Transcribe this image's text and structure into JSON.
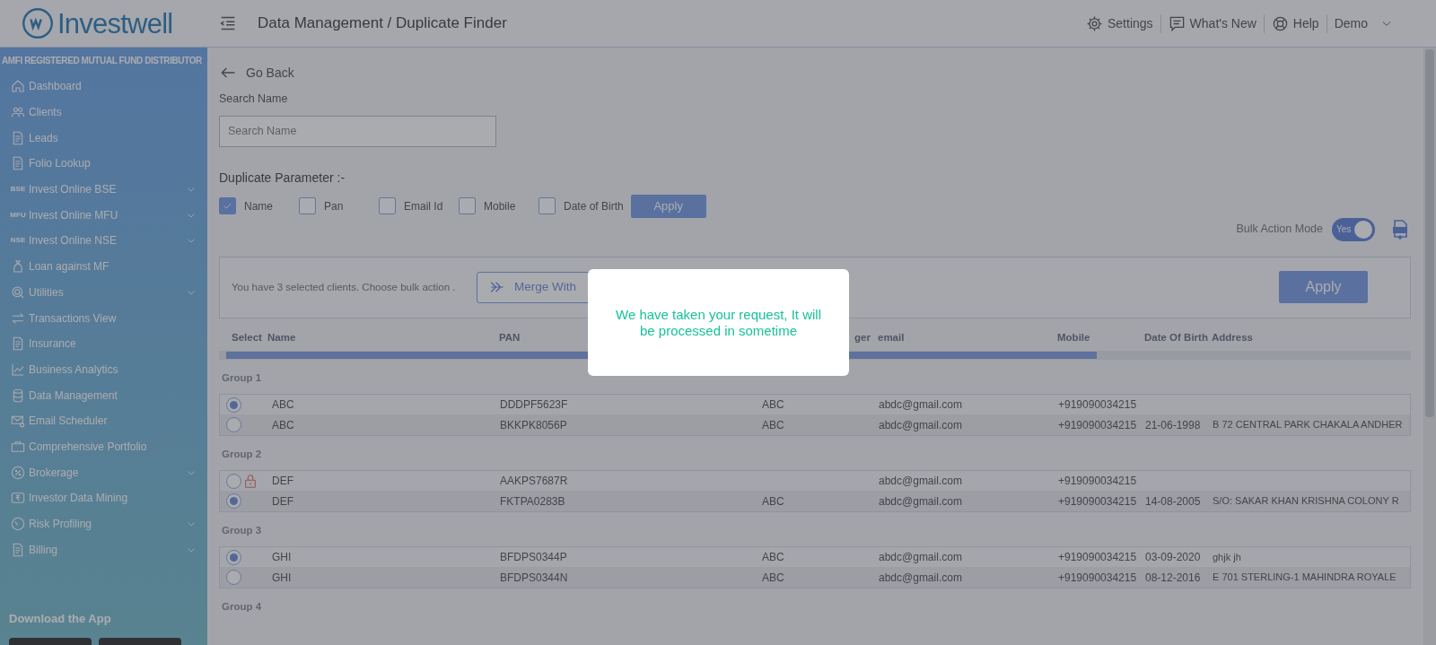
{
  "brand": {
    "name": "Investwell"
  },
  "header": {
    "breadcrumb": "Data Management / Duplicate Finder",
    "links": [
      {
        "label": "Settings",
        "kind": "settings"
      },
      {
        "label": "What's New",
        "kind": "news"
      },
      {
        "label": "Help",
        "kind": "help"
      }
    ],
    "user": "Demo"
  },
  "sidebar": {
    "tagline": "AMFI REGISTERED MUTUAL FUND DISTRIBUTOR",
    "items": [
      {
        "label": "Dashboard",
        "expandable": false
      },
      {
        "label": "Clients",
        "expandable": false
      },
      {
        "label": "Leads",
        "expandable": false
      },
      {
        "label": "Folio Lookup",
        "expandable": false
      },
      {
        "label": "Invest Online BSE",
        "icon_text": "BSE",
        "expandable": true
      },
      {
        "label": "Invest Online MFU",
        "icon_text": "MFU",
        "expandable": true
      },
      {
        "label": "Invest Online NSE",
        "icon_text": "NSE",
        "expandable": true
      },
      {
        "label": "Loan against MF",
        "expandable": false
      },
      {
        "label": "Utilities",
        "expandable": true
      },
      {
        "label": "Transactions View",
        "expandable": false
      },
      {
        "label": "Insurance",
        "expandable": false
      },
      {
        "label": "Business Analytics",
        "expandable": false
      },
      {
        "label": "Data Management",
        "expandable": false
      },
      {
        "label": "Email Scheduler",
        "expandable": false
      },
      {
        "label": "Comprehensive Portfolio",
        "expandable": false
      },
      {
        "label": "Brokerage",
        "expandable": true
      },
      {
        "label": "Investor Data Mining",
        "expandable": false
      },
      {
        "label": "Risk Profiling",
        "expandable": true
      },
      {
        "label": "Billing",
        "expandable": true
      }
    ],
    "download": {
      "title": "Download the App"
    }
  },
  "back": {
    "label": "Go Back"
  },
  "search": {
    "label": "Search Name",
    "placeholder": "Search Name"
  },
  "parameters": {
    "title": "Duplicate Parameter :-",
    "options": [
      {
        "label": "Name",
        "checked": true
      },
      {
        "label": "Pan",
        "checked": false
      },
      {
        "label": "Email Id",
        "checked": false
      },
      {
        "label": "Mobile",
        "checked": false
      },
      {
        "label": "Date of Birth",
        "checked": false
      }
    ],
    "apply": "Apply"
  },
  "bulk_mode": {
    "label": "Bulk Action Mode",
    "on": true,
    "value": "Yes"
  },
  "bulk_panel": {
    "message": "You have 3 selected clients. Choose bulk action .",
    "merge": "Merge With",
    "apply": "Apply"
  },
  "table": {
    "columns": [
      "Select",
      "Name",
      "PAN",
      "ger",
      "email",
      "Mobile",
      "Date Of Birth",
      "Address"
    ],
    "groups": [
      {
        "title": "Group 1",
        "rows": [
          {
            "selected": true,
            "locked": false,
            "cells": [
              "ABC",
              "DDDPF5623F",
              "ABC",
              "abdc@gmail.com",
              "+919090034215",
              "",
              ""
            ]
          },
          {
            "selected": false,
            "locked": false,
            "cells": [
              "ABC",
              "BKKPK8056P",
              "ABC",
              "abdc@gmail.com",
              "+919090034215",
              "21-06-1998",
              "B 72 CENTRAL PARK CHAKALA ANDHER"
            ]
          }
        ]
      },
      {
        "title": "Group 2",
        "rows": [
          {
            "selected": false,
            "locked": true,
            "cells": [
              "DEF",
              "AAKPS7687R",
              "",
              "abdc@gmail.com",
              "+919090034215",
              "",
              ""
            ]
          },
          {
            "selected": true,
            "locked": false,
            "cells": [
              "DEF",
              "FKTPA0283B",
              "ABC",
              "abdc@gmail.com",
              "+919090034215",
              "14-08-2005",
              "S/O: SAKAR KHAN KRISHNA COLONY R"
            ]
          }
        ]
      },
      {
        "title": "Group 3",
        "rows": [
          {
            "selected": true,
            "locked": false,
            "cells": [
              "GHI",
              "BFDPS0344P",
              "ABC",
              "abdc@gmail.com",
              "+919090034215",
              "03-09-2020",
              "ghjk jh"
            ]
          },
          {
            "selected": false,
            "locked": false,
            "cells": [
              "GHI",
              "BFDPS0344N",
              "ABC",
              "abdc@gmail.com",
              "+919090034215",
              "08-12-2016",
              "E 701 STERLING-1 MAHINDRA ROYALE"
            ]
          }
        ]
      },
      {
        "title": "Group 4"
      }
    ]
  },
  "modal": {
    "message": "We have taken your request, It will be processed in sometime"
  }
}
